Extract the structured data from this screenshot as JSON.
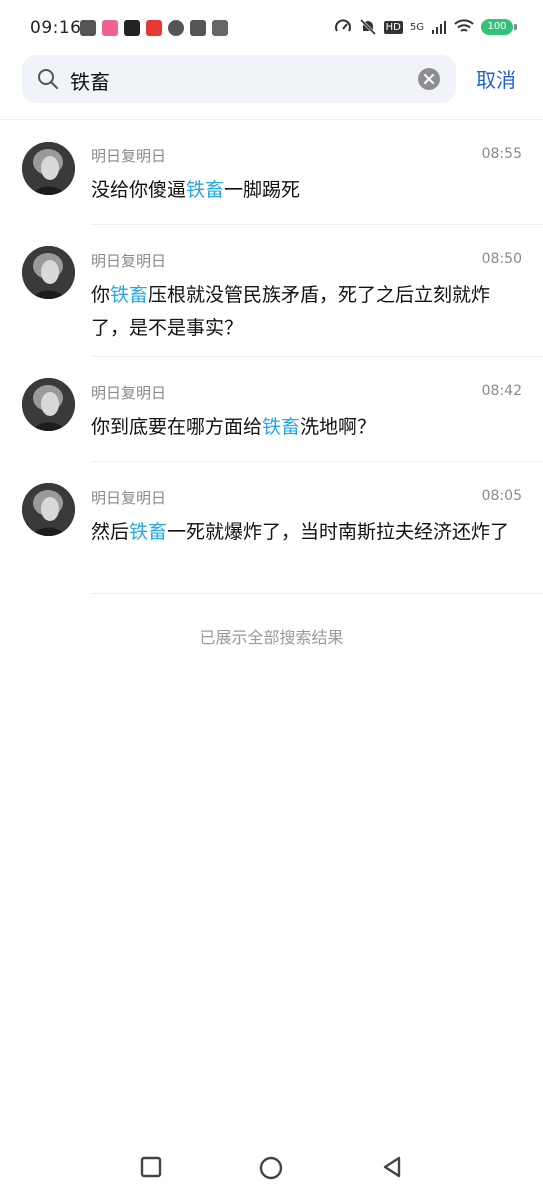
{
  "status_bar": {
    "time": "09:16",
    "battery": "100",
    "network": "5G",
    "hd": "HD"
  },
  "search": {
    "query": "铁畜",
    "placeholder": "",
    "cancel_label": "取消"
  },
  "highlight_color": "#27a8e0",
  "results": [
    {
      "sender": "明日复明日",
      "time": "08:55",
      "parts": [
        {
          "t": "没给你傻逼",
          "hl": false
        },
        {
          "t": "铁畜",
          "hl": true
        },
        {
          "t": "一脚踢死",
          "hl": false
        }
      ]
    },
    {
      "sender": "明日复明日",
      "time": "08:50",
      "parts": [
        {
          "t": "你",
          "hl": false
        },
        {
          "t": "铁畜",
          "hl": true
        },
        {
          "t": "压根就没管民族矛盾，死了之后立刻就炸了，是不是事实？",
          "hl": false
        }
      ]
    },
    {
      "sender": "明日复明日",
      "time": "08:42",
      "parts": [
        {
          "t": "你到底要在哪方面给",
          "hl": false
        },
        {
          "t": "铁畜",
          "hl": true
        },
        {
          "t": "洗地啊？",
          "hl": false
        }
      ]
    },
    {
      "sender": "明日复明日",
      "time": "08:05",
      "parts": [
        {
          "t": "然后",
          "hl": false
        },
        {
          "t": "铁畜",
          "hl": true
        },
        {
          "t": "一死就爆炸了，当时南斯拉夫经济还炸了",
          "hl": false
        }
      ]
    }
  ],
  "footer_note": "已展示全部搜索结果",
  "nav": {
    "recent_icon": "square-icon",
    "home_icon": "circle-icon",
    "back_icon": "triangle-back-icon"
  }
}
